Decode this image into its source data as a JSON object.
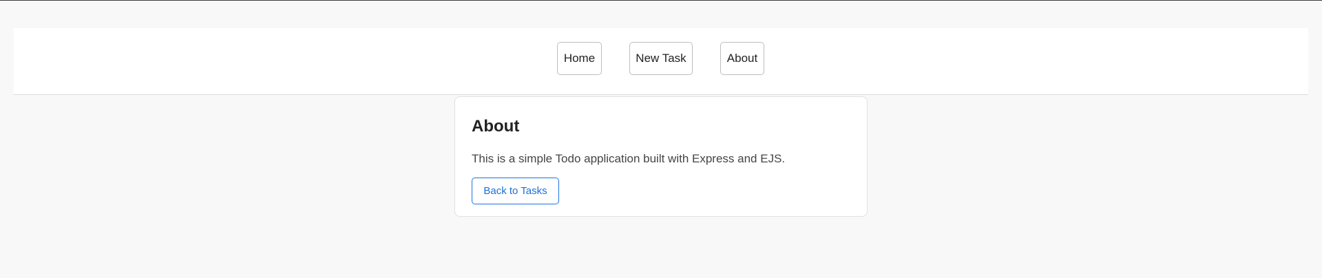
{
  "nav": {
    "home_label": "Home",
    "new_task_label": "New Task",
    "about_label": "About"
  },
  "about_card": {
    "title": "About",
    "description": "This is a simple Todo application built with Express and EJS.",
    "back_label": "Back to Tasks"
  },
  "colors": {
    "page_background": "#f8f8f8",
    "accent": "#1a73e8"
  }
}
